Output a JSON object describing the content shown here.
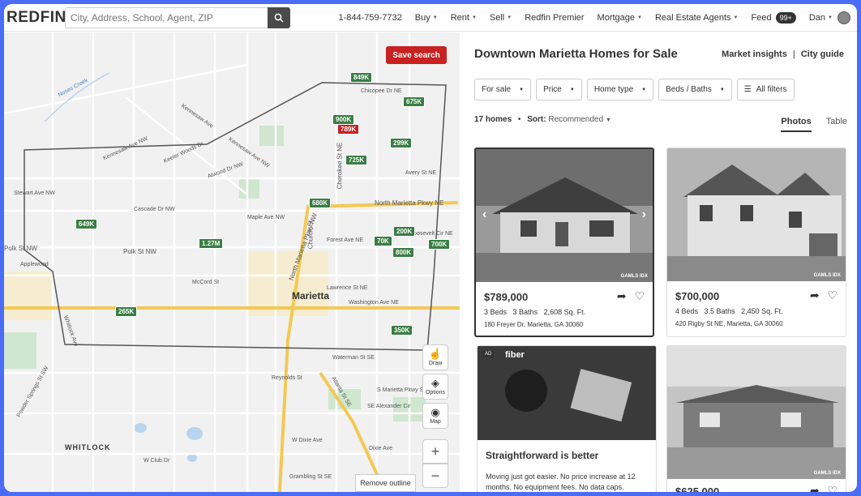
{
  "header": {
    "logo": "REDFIN",
    "search_placeholder": "City, Address, School, Agent, ZIP",
    "phone": "1-844-759-7732",
    "nav": [
      "Buy",
      "Rent",
      "Sell",
      "Redfin Premier",
      "Mortgage",
      "Real Estate Agents",
      "Feed"
    ],
    "feed_badge": "99+",
    "user": "Dan"
  },
  "map": {
    "save_search": "Save search",
    "remove_outline": "Remove outline",
    "draw_label": "Draw",
    "options_label": "Options",
    "map_label": "Map",
    "zoom_in": "+",
    "zoom_out": "−",
    "city": "Marietta",
    "area": "WHITLOCK",
    "price_tags": [
      "849K",
      "675K",
      "900K",
      "789K",
      "299K",
      "725K",
      "680K",
      "649K",
      "1.27M",
      "70K",
      "200K",
      "800K",
      "700K",
      "265K",
      "350K"
    ],
    "streets": [
      "Noses Creek",
      "Kennesaw Ave",
      "Kennesaw Ave NW",
      "Chicopee Dr NE",
      "Keeler Woods Dr",
      "Atwood Dr NW",
      "Stewart Ave NW",
      "Cascade Dr NW",
      "Maple Ave NW",
      "Polk St NW",
      "Polk St NW",
      "Applewood",
      "North Marietta Pkwy NE",
      "North Marietta Pkwy NW",
      "Church St",
      "Cherokee St NE",
      "Forest Ave NE",
      "Roosevelt Cir NE",
      "McCord St",
      "Lawrence St NE",
      "Washington Ave NE",
      "Waterman St SE",
      "Reynolds St",
      "S Marietta Pkwy SE",
      "Atlanta St SE",
      "W Dixie Ave",
      "Grambling St SE",
      "W Club Dr",
      "Powder Springs St SW",
      "Whitlock Ave",
      "Avery St NE",
      "Dixie Ave",
      "SE Alexander Cir",
      "Kennesaw Ave NW"
    ]
  },
  "panel": {
    "title": "Downtown Marietta Homes for Sale",
    "market_insights": "Market insights",
    "divider": "|",
    "city_guide": "City guide",
    "filters": [
      "For sale",
      "Price",
      "Home type",
      "Beds / Baths",
      "All filters"
    ],
    "count": "17 homes",
    "sort_label": "Sort:",
    "sort_value": "Recommended",
    "tabs": [
      "Photos",
      "Table"
    ],
    "listings": [
      {
        "price": "$789,000",
        "beds": "3 Beds",
        "baths": "3 Baths",
        "sqft": "2,608 Sq. Ft.",
        "address": "180 Freyer Dr, Marietta, GA 30060",
        "mls": "GAMLS IDX"
      },
      {
        "price": "$700,000",
        "beds": "4 Beds",
        "baths": "3.5 Baths",
        "sqft": "2,450 Sq. Ft.",
        "address": "420 Rigby St NE, Marietta, GA 30060",
        "mls": "GAMLS IDX"
      },
      {
        "price": "$625,000",
        "mls": "GAMLS IDX"
      }
    ],
    "ad": {
      "badge": "AD",
      "brand": "fiber",
      "title": "Straightforward is better",
      "text": "Moving just got easier. No price increase at 12 months. No equipment fees. No data caps."
    }
  }
}
